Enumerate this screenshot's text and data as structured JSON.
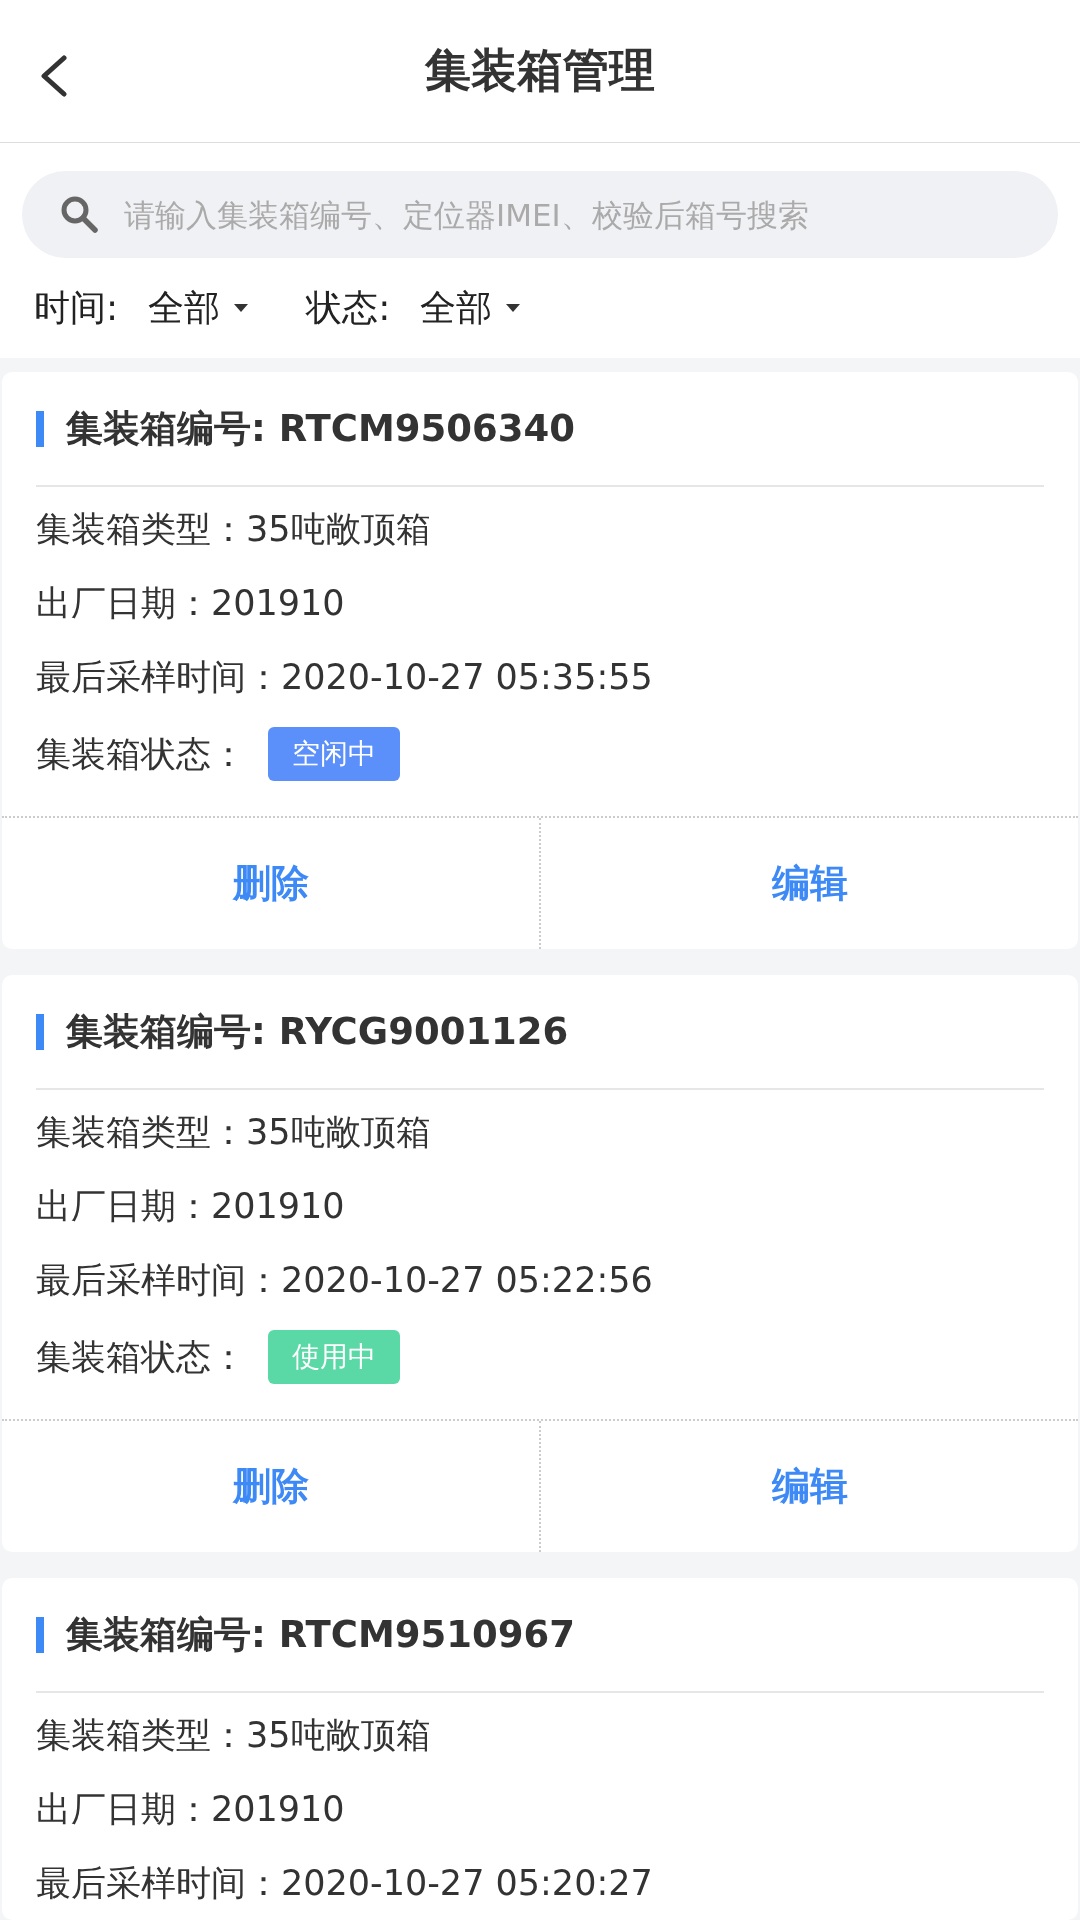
{
  "header": {
    "title": "集装箱管理"
  },
  "search": {
    "placeholder": "请输入集装箱编号、定位器IMEI、校验后箱号搜索"
  },
  "filters": [
    {
      "label": "时间:",
      "value": "全部"
    },
    {
      "label": "状态:",
      "value": "全部"
    }
  ],
  "cards": [
    {
      "title": "集装箱编号: RTCM9506340",
      "fields": [
        "集装箱类型：35吨敞顶箱",
        "出厂日期：201910",
        "最后采样时间：2020-10-27 05:35:55"
      ],
      "status_label": "集装箱状态：",
      "status": {
        "text": "空闲中",
        "color": "#5b8ff9"
      },
      "actions": [
        "删除",
        "编辑"
      ]
    },
    {
      "title": "集装箱编号: RYCG9001126",
      "fields": [
        "集装箱类型：35吨敞顶箱",
        "出厂日期：201910",
        "最后采样时间：2020-10-27 05:22:56"
      ],
      "status_label": "集装箱状态：",
      "status": {
        "text": "使用中",
        "color": "#5ad8a6"
      },
      "actions": [
        "删除",
        "编辑"
      ]
    },
    {
      "title": "集装箱编号: RTCM9510967",
      "fields": [
        "集装箱类型：35吨敞顶箱",
        "出厂日期：201910",
        "最后采样时间：2020-10-27 05:20:27"
      ]
    }
  ]
}
